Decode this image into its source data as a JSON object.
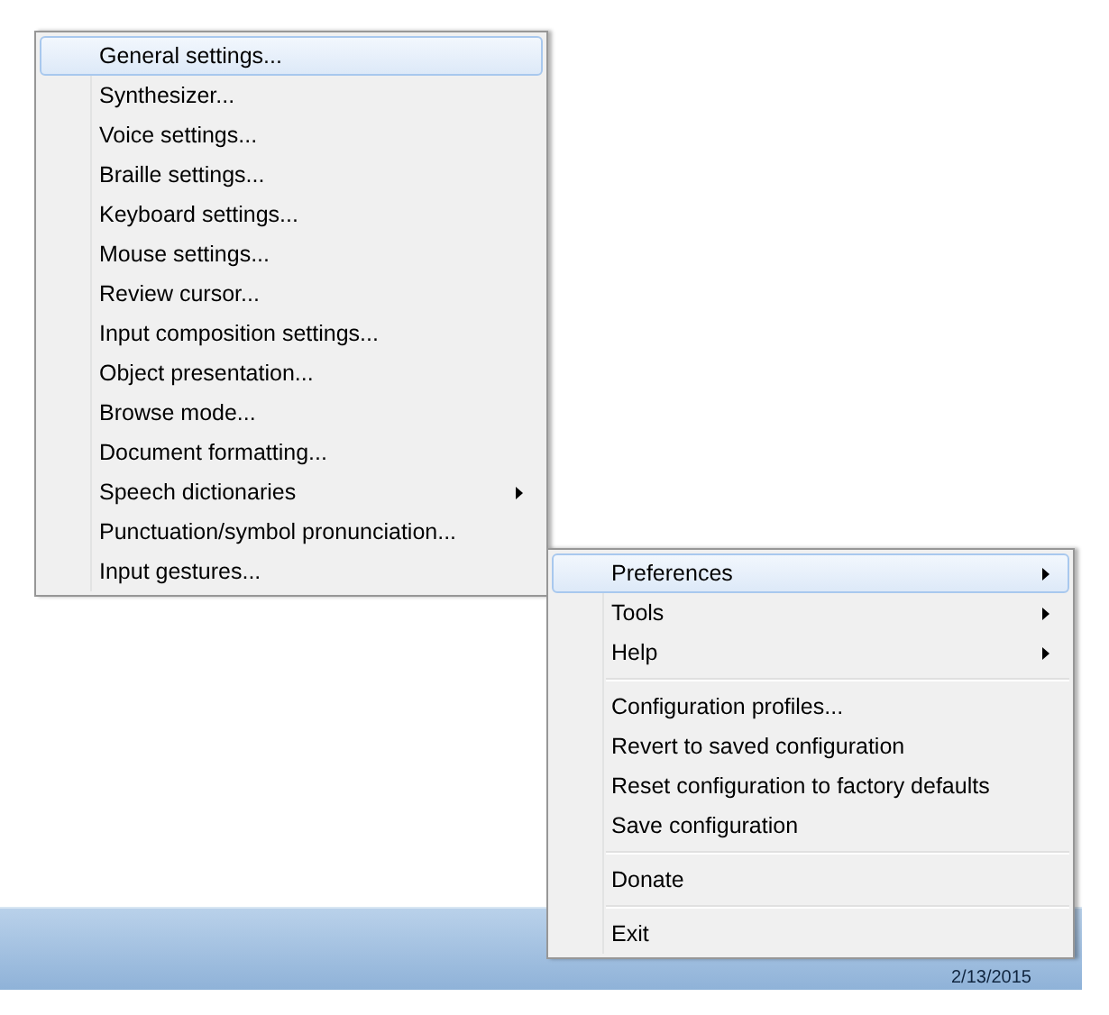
{
  "preferences_submenu": {
    "items": [
      {
        "label": "General settings...",
        "selected": true,
        "submenu": false
      },
      {
        "label": "Synthesizer...",
        "selected": false,
        "submenu": false
      },
      {
        "label": "Voice settings...",
        "selected": false,
        "submenu": false
      },
      {
        "label": "Braille settings...",
        "selected": false,
        "submenu": false
      },
      {
        "label": "Keyboard settings...",
        "selected": false,
        "submenu": false
      },
      {
        "label": "Mouse settings...",
        "selected": false,
        "submenu": false
      },
      {
        "label": "Review cursor...",
        "selected": false,
        "submenu": false
      },
      {
        "label": "Input composition settings...",
        "selected": false,
        "submenu": false
      },
      {
        "label": "Object presentation...",
        "selected": false,
        "submenu": false
      },
      {
        "label": "Browse mode...",
        "selected": false,
        "submenu": false
      },
      {
        "label": "Document formatting...",
        "selected": false,
        "submenu": false
      },
      {
        "label": "Speech dictionaries",
        "selected": false,
        "submenu": true
      },
      {
        "label": "Punctuation/symbol pronunciation...",
        "selected": false,
        "submenu": false
      },
      {
        "label": "Input gestures...",
        "selected": false,
        "submenu": false
      }
    ]
  },
  "main_menu": {
    "groups": [
      [
        {
          "label": "Preferences",
          "selected": true,
          "submenu": true
        },
        {
          "label": "Tools",
          "selected": false,
          "submenu": true
        },
        {
          "label": "Help",
          "selected": false,
          "submenu": true
        }
      ],
      [
        {
          "label": "Configuration profiles...",
          "selected": false,
          "submenu": false
        },
        {
          "label": "Revert to saved configuration",
          "selected": false,
          "submenu": false
        },
        {
          "label": "Reset configuration to factory defaults",
          "selected": false,
          "submenu": false
        },
        {
          "label": "Save configuration",
          "selected": false,
          "submenu": false
        }
      ],
      [
        {
          "label": "Donate",
          "selected": false,
          "submenu": false
        }
      ],
      [
        {
          "label": "Exit",
          "selected": false,
          "submenu": false
        }
      ]
    ]
  },
  "taskbar": {
    "date": "2/13/2015"
  }
}
